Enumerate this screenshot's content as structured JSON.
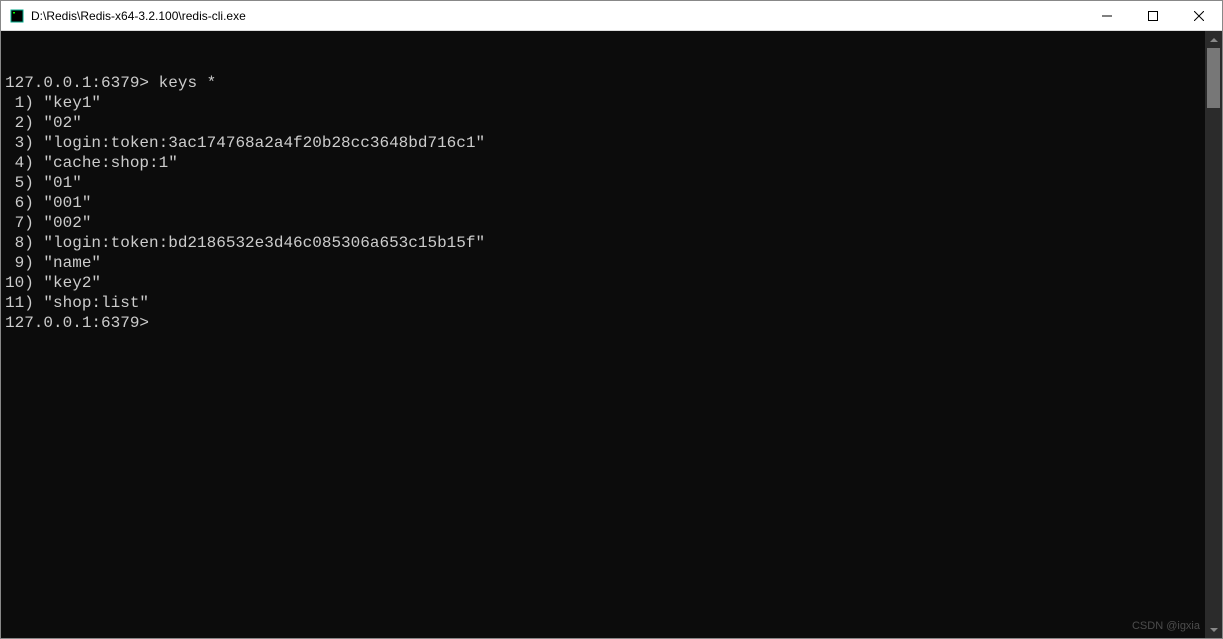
{
  "window": {
    "title": "D:\\Redis\\Redis-x64-3.2.100\\redis-cli.exe"
  },
  "terminal": {
    "prompt": "127.0.0.1:6379>",
    "command": "keys *",
    "results": [
      {
        "index": " 1)",
        "value": "\"key1\""
      },
      {
        "index": " 2)",
        "value": "\"02\""
      },
      {
        "index": " 3)",
        "value": "\"login:token:3ac174768a2a4f20b28cc3648bd716c1\""
      },
      {
        "index": " 4)",
        "value": "\"cache:shop:1\""
      },
      {
        "index": " 5)",
        "value": "\"01\""
      },
      {
        "index": " 6)",
        "value": "\"001\""
      },
      {
        "index": " 7)",
        "value": "\"002\""
      },
      {
        "index": " 8)",
        "value": "\"login:token:bd2186532e3d46c085306a653c15b15f\""
      },
      {
        "index": " 9)",
        "value": "\"name\""
      },
      {
        "index": "10)",
        "value": "\"key2\""
      },
      {
        "index": "11)",
        "value": "\"shop:list\""
      }
    ],
    "current_prompt": "127.0.0.1:6379>"
  },
  "watermark": "CSDN @igxia"
}
